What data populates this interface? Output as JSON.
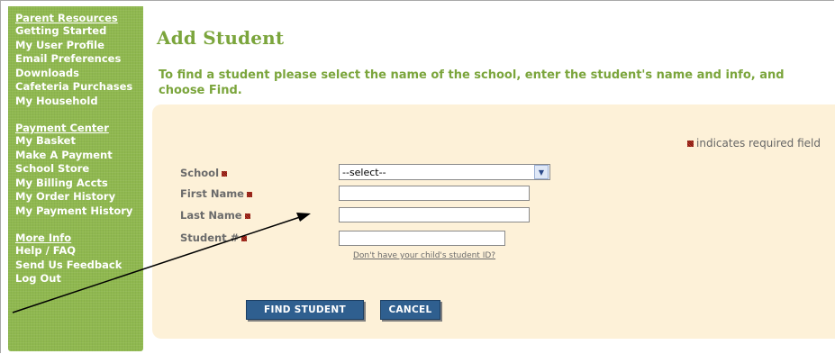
{
  "sidebar": {
    "sections": [
      {
        "heading": "Parent Resources",
        "items": [
          "Getting Started",
          "My User Profile",
          "Email Preferences",
          "Downloads",
          "Cafeteria Purchases",
          "My Household"
        ]
      },
      {
        "heading": "Payment Center",
        "items": [
          "My Basket",
          "Make A Payment",
          "School Store",
          "My Billing Accts",
          "My Order History",
          "My Payment History"
        ]
      },
      {
        "heading": "More Info",
        "items": [
          "Help / FAQ",
          "Send Us Feedback",
          "Log Out"
        ]
      }
    ]
  },
  "main": {
    "title": "Add Student",
    "intro": "To find a student please select the name of the school, enter the student's name and info, and choose Find.",
    "required_note": "indicates required field",
    "form": {
      "school_label": "School",
      "school_value": "--select--",
      "first_name_label": "First Name",
      "first_name_value": "",
      "last_name_label": "Last Name",
      "last_name_value": "",
      "student_num_label": "Student #",
      "student_num_value": "",
      "help_link": "Don't have your child's student ID?"
    },
    "buttons": {
      "find": "FIND STUDENT",
      "cancel": "CANCEL"
    }
  },
  "colors": {
    "sidebar_bg": "#8fb84f",
    "accent_green": "#7ba53c",
    "panel_bg": "#fdf1d8",
    "button_bg": "#2f5f8f",
    "required_mark": "#c0392b"
  }
}
